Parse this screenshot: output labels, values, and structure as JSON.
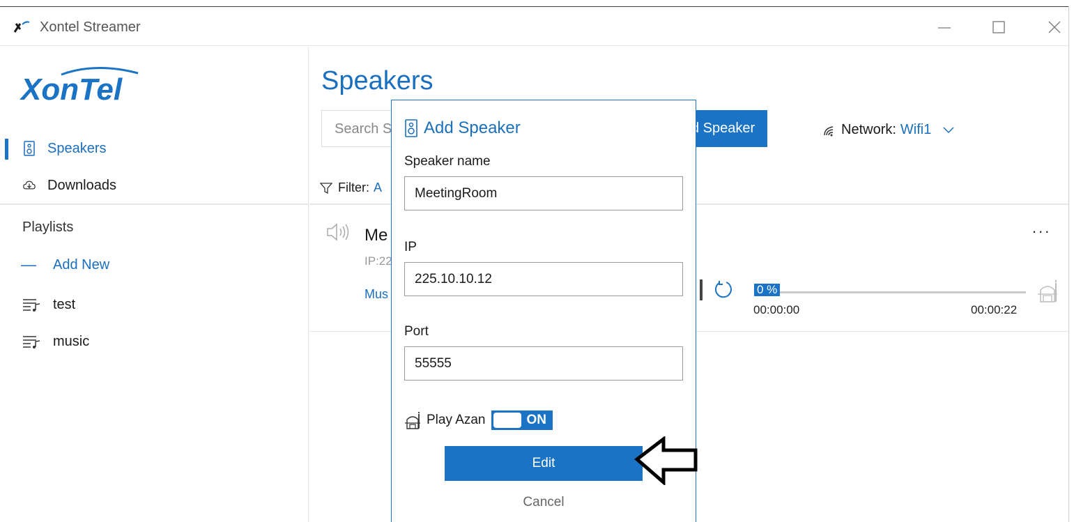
{
  "window": {
    "title": "Xontel Streamer",
    "app_icon": "xontel-app-icon",
    "controls": [
      "minimize-icon",
      "maximize-icon",
      "close-icon"
    ]
  },
  "sidebar": {
    "logo_text": "XonTel",
    "nav": [
      {
        "label": "Speakers",
        "icon": "speaker-icon",
        "active": true
      },
      {
        "label": "Downloads",
        "icon": "cloud-download-icon",
        "active": false
      }
    ],
    "playlists_heading": "Playlists",
    "add_new_label": "Add New",
    "playlists": [
      {
        "label": "test",
        "icon": "playlist-icon"
      },
      {
        "label": "music",
        "icon": "playlist-icon"
      }
    ]
  },
  "main": {
    "title": "Speakers",
    "search_placeholder": "Search S",
    "add_speaker_label": "d Speaker",
    "network_label": "Network:",
    "network_value": "Wifi1",
    "filter_label": "Filter:",
    "filter_value": "A",
    "card": {
      "name": "Me",
      "ip": "IP:22",
      "music": "Mus",
      "more": "...",
      "progress_percent": 0,
      "progress_text": "0 %",
      "time_start": "00:00:00",
      "time_end": "00:00:22"
    }
  },
  "dialog": {
    "title": "Add Speaker",
    "speaker_name_label": "Speaker name",
    "speaker_name_value": "MeetingRoom",
    "ip_label": "IP",
    "ip_value": "225.10.10.12",
    "port_label": "Port",
    "port_value": "55555",
    "play_azan_label": "Play Azan",
    "toggle_text": "ON",
    "edit_label": "Edit",
    "cancel_label": "Cancel"
  },
  "colors": {
    "accent": "#1a73c5",
    "link": "#1a6fbf"
  }
}
